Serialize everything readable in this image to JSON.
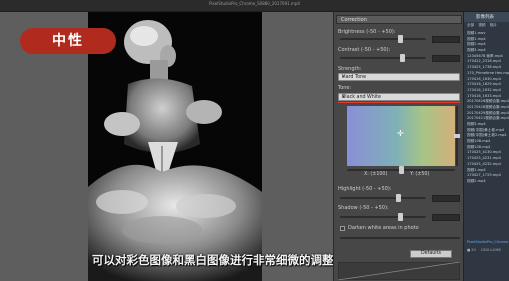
{
  "window": {
    "title": "PixelStudioPro_Chrome_S0880_2017091.mp4"
  },
  "overlay": {
    "badge": "中性",
    "subtitle": "可以对彩色图像和黑白图像进行非常细微的调整"
  },
  "correction_panel": {
    "header": "Correction",
    "brightness_label": "Brightness (-50 - +50):",
    "contrast_label": "Contrast (-50 - +50):",
    "strength_label": "Strength:",
    "strength_value": "Hard Tone",
    "tone_label": "Tone:",
    "tone_value": "Black and White",
    "x_label": "X: (±100)",
    "y_label": "Y: (±50)",
    "highlight_label": "Highlight (-50 - +50):",
    "shadow_label": "Shadow (-50 - +50):",
    "darken_label": "Darken white areas in photo",
    "defaults_button": "Defaults"
  },
  "file_panel": {
    "title": "影像列表",
    "tabs": [
      "全部",
      "视频",
      "相片"
    ],
    "items": [
      "视频1.mov",
      "视频1.mp4",
      "视频2.mp4",
      "视频3.mp4",
      "12345678 帧率.mp4",
      "170422_2318.mp4",
      "170425_1738.mp4",
      "170_Primetime Hex.mp4",
      "170416_1630.mp4",
      "170416_1629.mp4",
      "170416_1632.mp4",
      "170416_1633.mp4",
      "20170416视频合集.mp4",
      "20170418视频合集.mp4",
      "20170429视频合集.mp4",
      "20170411视频合集.mp4",
      "视频3.mp4",
      "视频(中国)黄土坡.mp4",
      "视频(中国)黄土坡2.mp4",
      "视频108.mp4",
      "视频108.mp4",
      "170425_4130.mp4",
      "170425_4231.mp4",
      "170425_4232.mp4",
      "视频1.mp4",
      "170427_1729.mp4",
      "视频2.mp4"
    ],
    "selected_index": 27,
    "selected_item": "PixelStudioPro_Chrome",
    "footer_left": "■ 20",
    "footer_right": "1920×1080"
  },
  "colors": {
    "accent_red": "#b02a1e",
    "highlight_line": "#e23b2e",
    "file_selected": "#5ea8ff"
  }
}
